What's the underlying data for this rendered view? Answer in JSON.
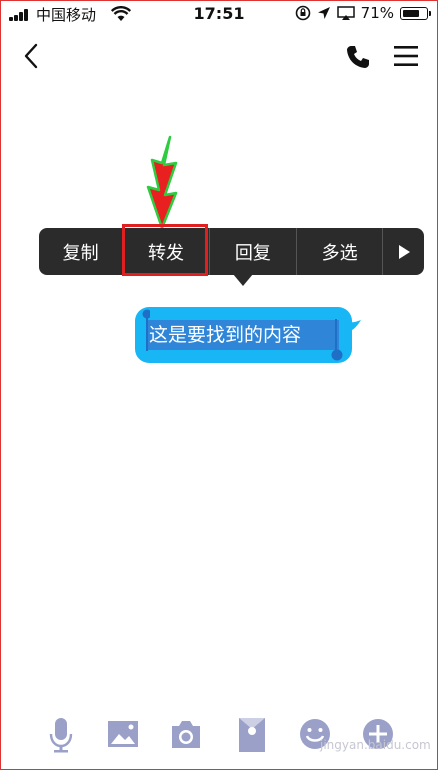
{
  "status_bar": {
    "carrier": "中国移动",
    "time": "17:51",
    "battery_percent": "71%",
    "icons": [
      "signal-icon",
      "wifi-icon",
      "rotation-lock-icon",
      "location-icon",
      "airplay-icon",
      "battery-icon"
    ]
  },
  "nav": {
    "icons": [
      "back-icon",
      "phone-icon",
      "menu-icon"
    ]
  },
  "context_menu": {
    "items": [
      "复制",
      "转发",
      "回复",
      "多选"
    ],
    "highlighted_index": 1,
    "more_icon": "right-triangle-icon"
  },
  "message": {
    "text": "这是要找到的内容"
  },
  "toolbar": {
    "icons": [
      "microphone-icon",
      "image-icon",
      "camera-icon",
      "red-packet-icon",
      "emoji-icon",
      "plus-icon"
    ]
  },
  "watermark": "jingyan.baidu.com",
  "colors": {
    "bubble": "#19b6f5",
    "selection": "#2f86d8",
    "menu_bg": "#2b2b2b",
    "highlight": "#e02020",
    "arrow_fill": "#e82020",
    "arrow_outline": "#2ecc40",
    "toolbar_icons": "#9aa0c8"
  }
}
